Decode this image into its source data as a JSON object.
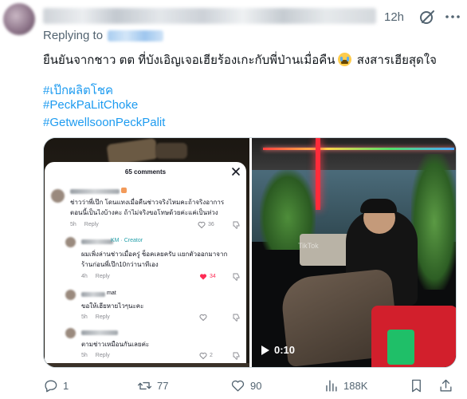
{
  "tweet": {
    "time": "12h",
    "reply_prefix": "Replying to",
    "text": "ยืนยันจากชาว ตต ที่บังเอิญเจอเฮียร้องเกะกับพี่ป่านเมื่อคืน",
    "text_suffix": " สงสารเฮียสุดใจ",
    "emoji_icon": "loudly-crying-face-icon",
    "hashtags": [
      "#เป๊กผลิตโชค",
      "#PeckPaLitChoke",
      "#GetwellsoonPeckPalit"
    ]
  },
  "media": {
    "comments_panel": {
      "title": "65 comments",
      "comments": [
        {
          "text_lines": [
            "ช่าวว่าพี่เป๊ก โดนแทงเมื่อคืนช่าวจริงไหมคะถ้าจริงอาการ",
            "ตอนนี้เป็นไงบ้างคะ ถ้าไม่จริงขอโทษด้วยค่ะแค่เป็นห่วง"
          ],
          "age": "5h",
          "reply": "Reply",
          "likes": "36",
          "liked": false
        },
        {
          "creator_tag": "KM · Creator",
          "text_lines": [
            "ผมเพิ่งล่านช่าวเมื่อครู่ ช็อคเลยครับ แยกตัวออกมาจาก",
            "ร้านก่อนพี่เป๊ก10กว่านาทีเอง"
          ],
          "age": "4h",
          "reply": "Reply",
          "likes": "34",
          "liked": true
        },
        {
          "user_suffix": "mat",
          "text_lines": [
            "ขอให้เฮียหายไวๆนะคะ"
          ],
          "age": "5h",
          "reply": "Reply",
          "likes": "",
          "liked": false
        },
        {
          "text_lines": [
            "ตามช่าวเหมือนกันเลยค่ะ"
          ],
          "age": "5h",
          "reply": "Reply",
          "likes": "2",
          "liked": false
        }
      ]
    },
    "video": {
      "duration": "0:10",
      "watermark": "TikTok"
    }
  },
  "actions": {
    "replies": "1",
    "reposts": "77",
    "likes": "90",
    "views": "188K"
  },
  "colors": {
    "link": "#1d9bf0",
    "secondary_text": "#536471",
    "like_red": "#fe2c55"
  }
}
